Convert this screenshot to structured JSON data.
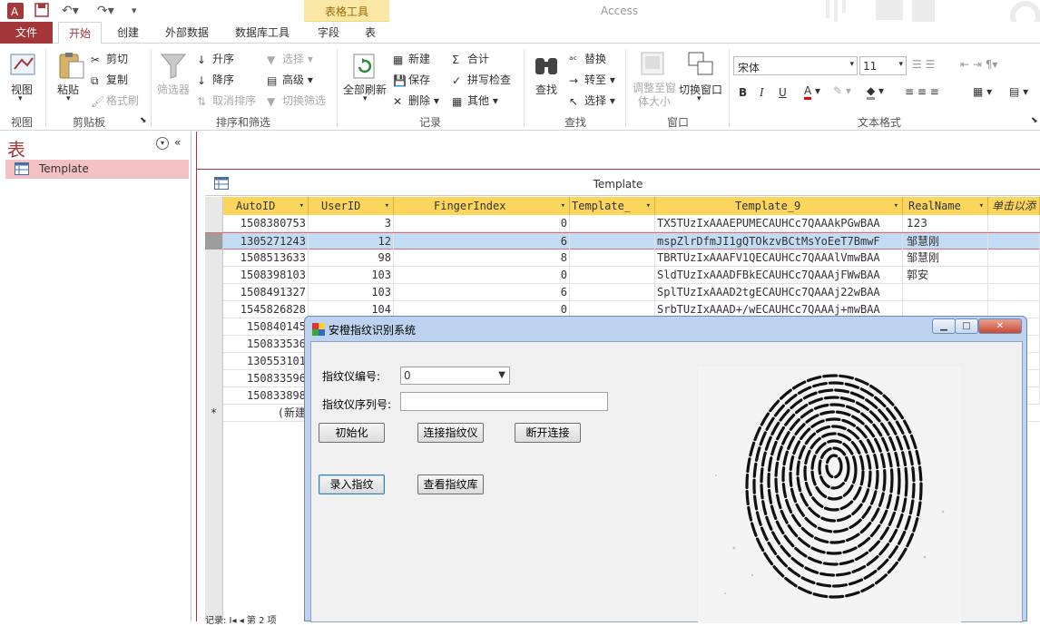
{
  "titlebar": {
    "app_title": "Access",
    "context_group": "表格工具"
  },
  "tabs": [
    {
      "label": "文件"
    },
    {
      "label": "开始"
    },
    {
      "label": "创建"
    },
    {
      "label": "外部数据"
    },
    {
      "label": "数据库工具"
    },
    {
      "label": "字段"
    },
    {
      "label": "表"
    }
  ],
  "ribbon": {
    "view": {
      "label": "视图",
      "group": "视图"
    },
    "clipboard": {
      "paste": "粘贴",
      "cut": "剪切",
      "copy": "复制",
      "format_painter": "格式刷",
      "group": "剪贴板"
    },
    "sort": {
      "filter": "筛选器",
      "ascending": "升序",
      "descending": "降序",
      "clear_sort": "取消排序",
      "selection": "选择",
      "advanced": "高级",
      "toggle_filter": "切换筛选",
      "group": "排序和筛选"
    },
    "records": {
      "refresh_all": "全部刷新",
      "new": "新建",
      "save": "保存",
      "delete": "删除",
      "totals": "合计",
      "spelling": "拼写检查",
      "more": "其他",
      "group": "记录"
    },
    "find": {
      "find": "查找",
      "replace": "替换",
      "goto": "转至",
      "select": "选择",
      "group": "查找"
    },
    "window": {
      "resize": "调整至窗体大小",
      "switch": "切换窗口",
      "group": "窗口"
    },
    "text": {
      "font": "宋体",
      "size": "11",
      "group": "文本格式",
      "bold": "B",
      "italic": "I",
      "underline": "U"
    }
  },
  "navpane": {
    "title": "表",
    "item": "Template"
  },
  "doc": {
    "caption": "Template"
  },
  "grid": {
    "columns": [
      "AutoID",
      "UserID",
      "FingerIndex",
      "Template_",
      "Template_9",
      "RealName",
      "单击以添加"
    ],
    "rows": [
      [
        "1508380753",
        "3",
        "0",
        "",
        "TX5TUzIxAAAEPUMECAUHCc7QAAAkPGwBAA",
        "123"
      ],
      [
        "1305271243",
        "12",
        "6",
        "",
        "mspZlrDfmJI1gQTOkzvBCtMsYoEeT7BmwF",
        "邹慧刚"
      ],
      [
        "1508513633",
        "98",
        "8",
        "",
        "TBRTUzIxAAAFV1QECAUHCc7QAAAlVmwBAA",
        "邹慧刚"
      ],
      [
        "1508398103",
        "103",
        "0",
        "",
        "SldTUzIxAAADFBkECAUHCc7QAAAjFWwBAA",
        "郭安"
      ],
      [
        "1508491327",
        "103",
        "6",
        "",
        "SplTUzIxAAAD2tgECAUHCc7QAAAj22wBAA",
        ""
      ],
      [
        "1545826828",
        "104",
        "0",
        "",
        "SrbTUzIxAAAD+/wECAUHCc7QAAAj+mwBAA",
        ""
      ],
      [
        "150840145",
        "",
        "",
        "",
        "",
        ""
      ],
      [
        "150833536",
        "",
        "",
        "",
        "",
        ""
      ],
      [
        "130553101",
        "",
        "",
        "",
        "",
        ""
      ],
      [
        "150833596",
        "",
        "",
        "",
        "",
        ""
      ],
      [
        "150833898",
        "",
        "",
        "",
        "",
        ""
      ]
    ],
    "new_row": "(新建",
    "new_marker": "*",
    "status": "记录: I◂ ◂ 第 2 项"
  },
  "dialog": {
    "title": "安橙指纹识别系统",
    "device_no_label": "指纹仪编号:",
    "device_no_value": "0",
    "serial_label": "指纹仪序列号:",
    "serial_value": "",
    "init_btn": "初始化",
    "connect_btn": "连接指纹仪",
    "disconnect_btn": "断开连接",
    "enroll_btn": "录入指纹",
    "view_btn": "查看指纹库"
  }
}
